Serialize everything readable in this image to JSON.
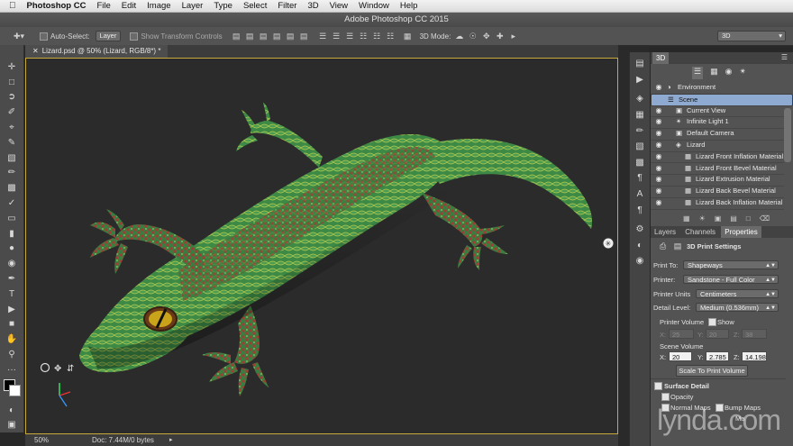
{
  "menubar": {
    "apple": "",
    "app_name": "Photoshop CC",
    "items": [
      "File",
      "Edit",
      "Image",
      "Layer",
      "Type",
      "Select",
      "Filter",
      "3D",
      "View",
      "Window",
      "Help"
    ]
  },
  "window": {
    "title": "Adobe Photoshop CC 2015"
  },
  "options_bar": {
    "auto_select_label": "Auto-Select:",
    "auto_select_value": "Layer",
    "show_transform_label": "Show Transform Controls",
    "mode_label": "3D Mode:",
    "workspace_value": "3D"
  },
  "document": {
    "tab_label": "Lizard.psd @ 50% (Lizard, RGB/8*) *",
    "zoom": "50%",
    "doc_info": "Doc: 7.44M/0 bytes"
  },
  "panel_3d": {
    "tab": "3D",
    "scene_items": [
      {
        "label": "Environment",
        "indent": 0,
        "selected": false
      },
      {
        "label": "Scene",
        "indent": 0,
        "selected": true
      },
      {
        "label": "Current View",
        "indent": 1,
        "selected": false
      },
      {
        "label": "Infinite Light 1",
        "indent": 1,
        "selected": false
      },
      {
        "label": "Default Camera",
        "indent": 1,
        "selected": false
      },
      {
        "label": "Lizard",
        "indent": 1,
        "selected": false
      },
      {
        "label": "Lizard Front Inflation Material",
        "indent": 2,
        "selected": false
      },
      {
        "label": "Lizard Front Bevel Material",
        "indent": 2,
        "selected": false
      },
      {
        "label": "Lizard Extrusion Material",
        "indent": 2,
        "selected": false
      },
      {
        "label": "Lizard Back Bevel Material",
        "indent": 2,
        "selected": false
      },
      {
        "label": "Lizard Back Inflation Material",
        "indent": 2,
        "selected": false
      }
    ]
  },
  "properties": {
    "tabs": [
      "Layers",
      "Channels",
      "Properties"
    ],
    "active_tab": "Properties",
    "section_title": "3D Print Settings",
    "print_to_label": "Print To:",
    "print_to_value": "Shapeways",
    "printer_label": "Printer:",
    "printer_value": "Sandstone - Full Color",
    "units_label": "Printer Units",
    "units_value": "Centimeters",
    "detail_label": "Detail Level:",
    "detail_value": "Medium (0.536mm)",
    "printer_volume_label": "Printer Volume",
    "show_label": "Show",
    "pv_x_label": "X:",
    "pv_x": "25",
    "pv_y_label": "Y:",
    "pv_y": "20",
    "pv_z_label": "Z:",
    "pv_z": "38",
    "scene_volume_label": "Scene Volume",
    "sv_x_label": "X:",
    "sv_x": "20",
    "sv_y_label": "Y:",
    "sv_y": "2.785",
    "sv_z_label": "Z:",
    "sv_z": "14.198",
    "scale_button": "Scale To Print Volume",
    "surface_detail_label": "Surface Detail",
    "opacity_label": "Opacity",
    "normal_maps_label": "Normal Maps",
    "bump_maps_label": "Bump Maps",
    "more_label": "Ma"
  },
  "watermark": "lynda.com",
  "colors": {
    "accent_selection": "#8faad0",
    "canvas_border": "#c7a83a",
    "lizard_green": "#3f8a45",
    "lizard_red": "#a33a33"
  }
}
